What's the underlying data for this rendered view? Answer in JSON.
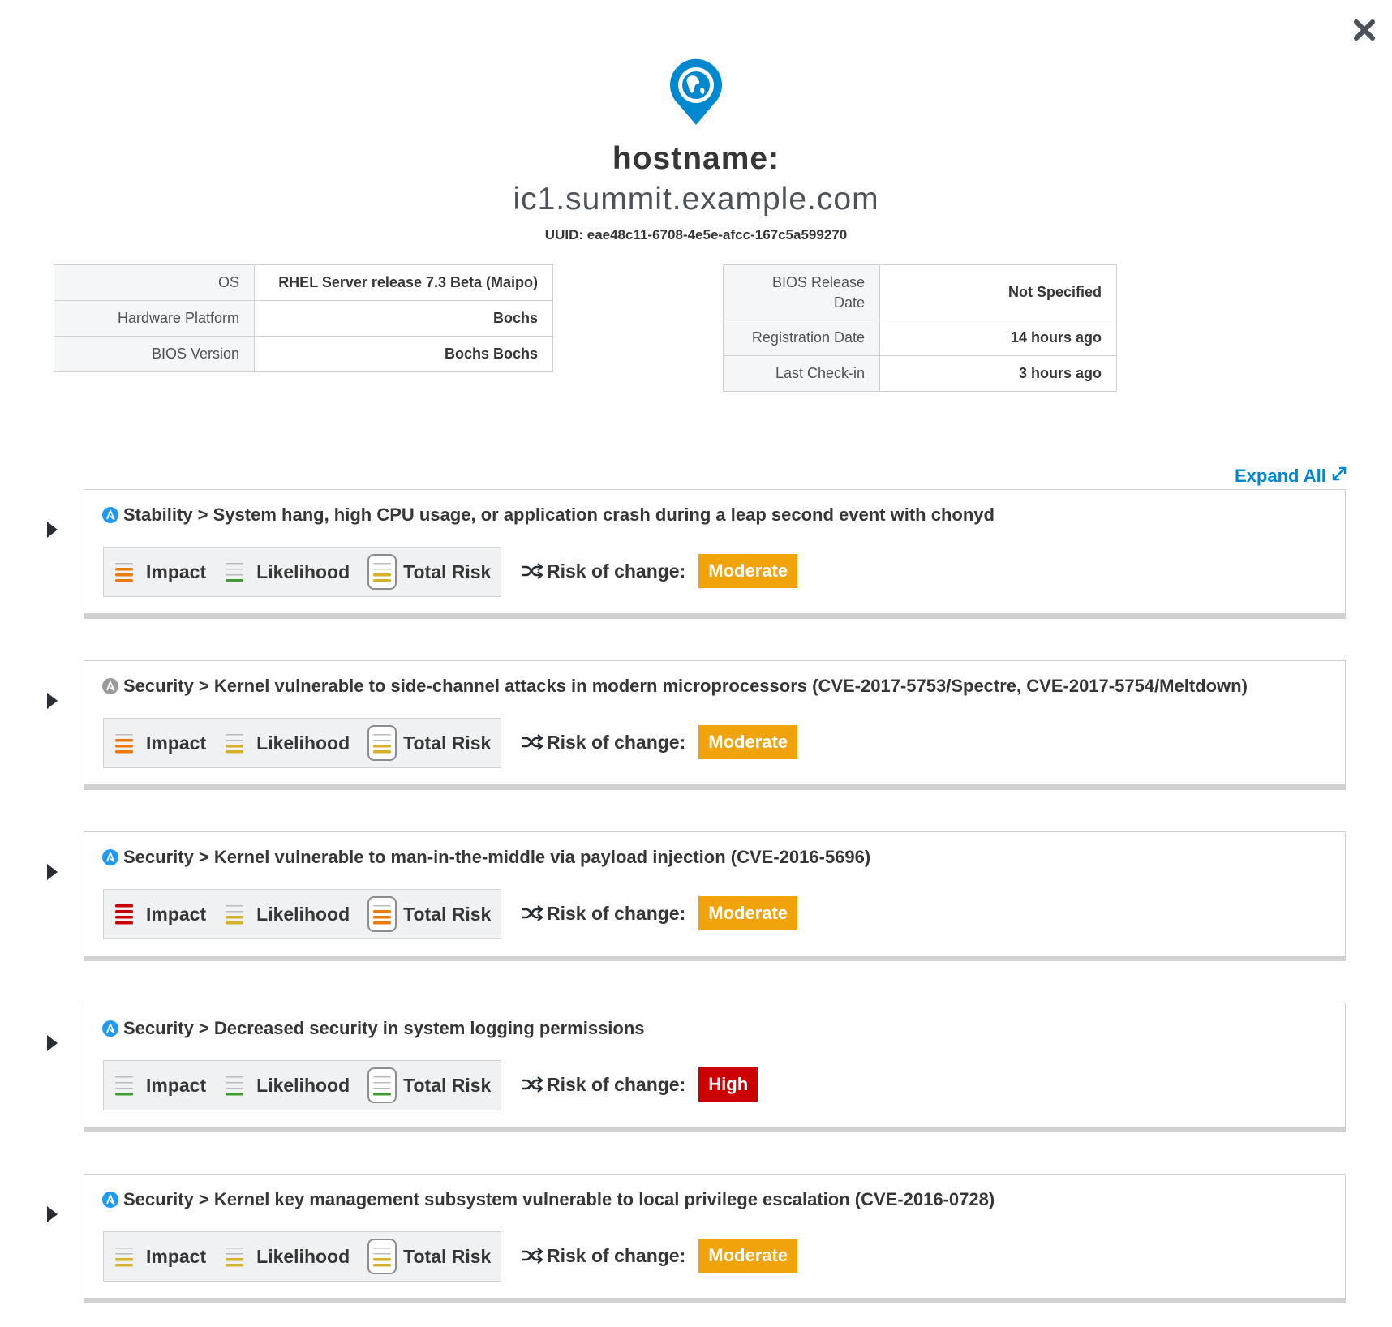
{
  "header": {
    "hostname_label": "hostname:",
    "hostname_value": "ic1.summit.example.com",
    "uuid_label": "UUID: eae48c11-6708-4e5e-afcc-167c5a599270"
  },
  "system_info_left": [
    {
      "label": "OS",
      "value": "RHEL Server release 7.3 Beta (Maipo)"
    },
    {
      "label": "Hardware Platform",
      "value": "Bochs"
    },
    {
      "label": "BIOS Version",
      "value": "Bochs Bochs"
    }
  ],
  "system_info_right": [
    {
      "label": "BIOS Release Date",
      "value": "Not Specified"
    },
    {
      "label": "Registration Date",
      "value": "14 hours ago"
    },
    {
      "label": "Last Check-in",
      "value": "3 hours ago"
    }
  ],
  "expand_all_label": "Expand All",
  "metric_labels": {
    "impact": "Impact",
    "likelihood": "Likelihood",
    "total_risk": "Total Risk"
  },
  "risk_of_change_label": "Risk of change:",
  "colors": {
    "level_1": "#3f9c35",
    "level_2": "#d5b22a",
    "level_3": "#ec7a08",
    "level_4": "#cc0000",
    "inactive_bar": "#bbbbbb",
    "ansible_blue": "#1e9bf0",
    "ansible_gray": "#9a9a9a",
    "moderate": "#f0a30a",
    "high": "#cc0000",
    "link": "#0088ce"
  },
  "icons": {
    "close": "close-icon",
    "globe": "globe-pin-icon",
    "expand": "expand-arrows-icon",
    "caret": "caret-right-icon",
    "ansible": "ansible-icon",
    "shuffle": "shuffle-icon"
  },
  "rules": [
    {
      "title": "Stability > System hang, high CPU usage, or application crash during a leap second event with chonyd",
      "ansible_supported": true,
      "impact": 3,
      "likelihood": 1,
      "total_risk": 2,
      "risk_of_change": "Moderate"
    },
    {
      "title": "Security > Kernel vulnerable to side-channel attacks in modern microprocessors (CVE-2017-5753/Spectre, CVE-2017-5754/Meltdown)",
      "ansible_supported": false,
      "impact": 3,
      "likelihood": 2,
      "total_risk": 2,
      "risk_of_change": "Moderate"
    },
    {
      "title": "Security > Kernel vulnerable to man-in-the-middle via payload injection (CVE-2016-5696)",
      "ansible_supported": true,
      "impact": 4,
      "likelihood": 2,
      "total_risk": 3,
      "risk_of_change": "Moderate"
    },
    {
      "title": "Security > Decreased security in system logging permissions",
      "ansible_supported": true,
      "impact": 1,
      "likelihood": 1,
      "total_risk": 1,
      "risk_of_change": "High"
    },
    {
      "title": "Security > Kernel key management subsystem vulnerable to local privilege escalation (CVE-2016-0728)",
      "ansible_supported": true,
      "impact": 2,
      "likelihood": 2,
      "total_risk": 2,
      "risk_of_change": "Moderate"
    }
  ]
}
